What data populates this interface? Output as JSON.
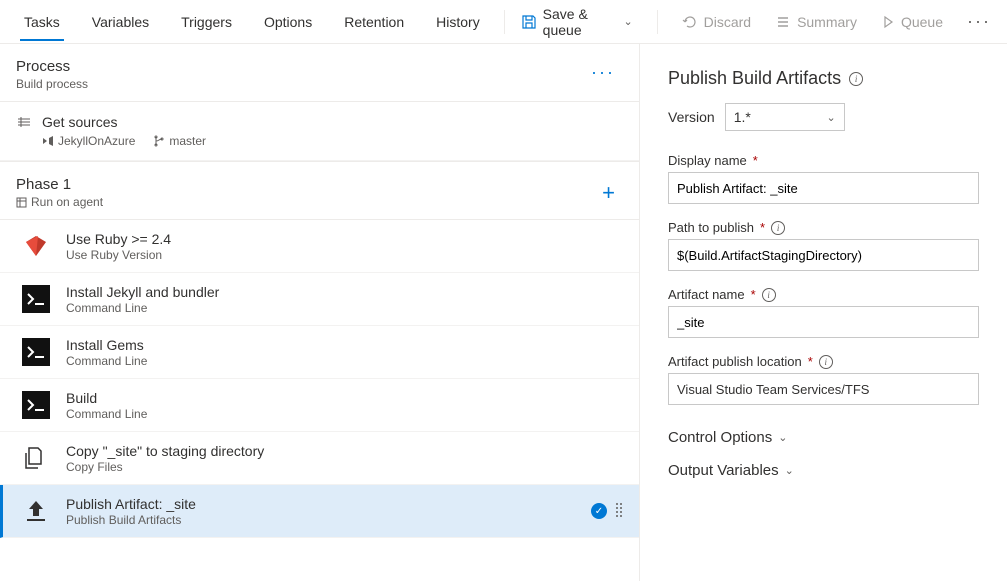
{
  "tabs": [
    "Tasks",
    "Variables",
    "Triggers",
    "Options",
    "Retention",
    "History"
  ],
  "commands": {
    "save": "Save & queue",
    "discard": "Discard",
    "summary": "Summary",
    "queue": "Queue"
  },
  "process": {
    "title": "Process",
    "sub": "Build process"
  },
  "getSources": {
    "title": "Get sources",
    "repo": "JekyllOnAzure",
    "branch": "master"
  },
  "phase": {
    "title": "Phase 1",
    "sub": "Run on agent"
  },
  "tasks": [
    {
      "title": "Use Ruby >= 2.4",
      "sub": "Use Ruby Version"
    },
    {
      "title": "Install Jekyll and bundler",
      "sub": "Command Line"
    },
    {
      "title": "Install Gems",
      "sub": "Command Line"
    },
    {
      "title": "Build",
      "sub": "Command Line"
    },
    {
      "title": "Copy \"_site\" to staging directory",
      "sub": "Copy Files"
    },
    {
      "title": "Publish Artifact: _site",
      "sub": "Publish Build Artifacts"
    }
  ],
  "panel": {
    "title": "Publish Build Artifacts",
    "versionLabel": "Version",
    "version": "1.*",
    "fields": {
      "displayName": {
        "label": "Display name",
        "value": "Publish Artifact: _site"
      },
      "pathToPublish": {
        "label": "Path to publish",
        "value": "$(Build.ArtifactStagingDirectory)"
      },
      "artifactName": {
        "label": "Artifact name",
        "value": "_site"
      },
      "publishLocation": {
        "label": "Artifact publish location",
        "value": "Visual Studio Team Services/TFS"
      }
    },
    "sections": {
      "control": "Control Options",
      "output": "Output Variables"
    }
  }
}
